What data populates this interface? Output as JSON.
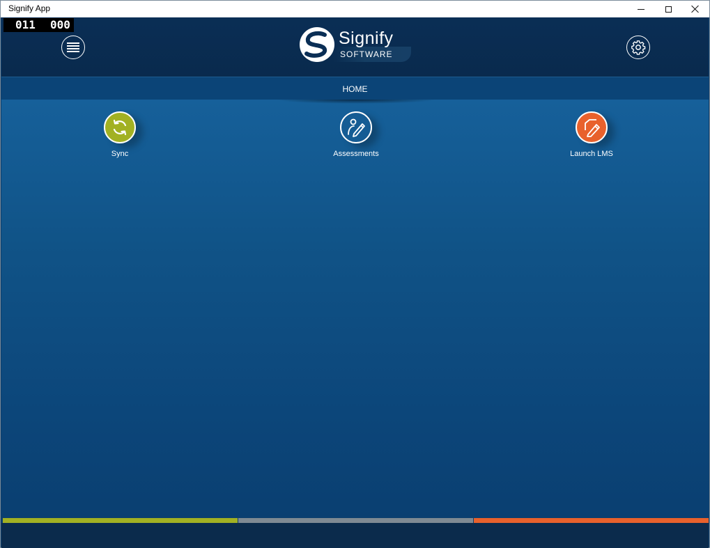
{
  "window": {
    "title": "Signify App"
  },
  "counter": {
    "left": "011",
    "right": "000"
  },
  "logo": {
    "name": "Signify",
    "tagline": "SOFTWARE"
  },
  "nav": {
    "current": "HOME"
  },
  "tiles": [
    {
      "label": "Sync",
      "icon": "sync-icon",
      "color": "#a2b123"
    },
    {
      "label": "Assessments",
      "icon": "assessment-pen-icon",
      "color": "#155c94"
    },
    {
      "label": "Launch LMS",
      "icon": "edit-document-icon",
      "color": "#e8612c"
    }
  ],
  "footer": {
    "bar_colors": [
      "#a2b123",
      "#7f8a93",
      "#e8612c"
    ]
  }
}
